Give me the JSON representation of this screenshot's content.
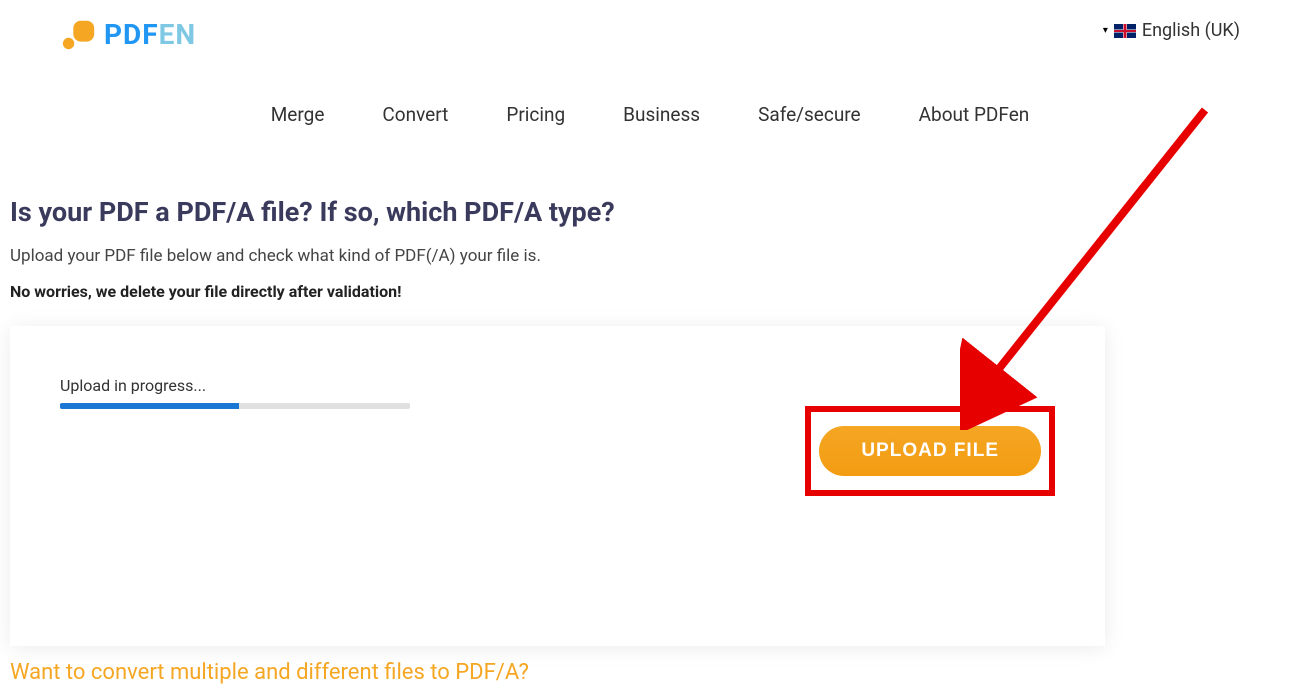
{
  "header": {
    "logo": {
      "text_pdf": "PDF",
      "text_en": "EN"
    },
    "language": {
      "label": "English (UK)"
    }
  },
  "nav": {
    "items": [
      "Merge",
      "Convert",
      "Pricing",
      "Business",
      "Safe/secure",
      "About PDFen"
    ]
  },
  "main": {
    "heading": "Is your PDF a PDF/A file? If so, which PDF/A type?",
    "subtext": "Upload your PDF file below and check what kind of PDF(/A) your file is.",
    "notice": "No worries, we delete your file directly after validation!",
    "upload": {
      "status": "Upload in progress...",
      "progress_percent": 51,
      "button_label": "UPLOAD FILE"
    },
    "bottom_link": "Want to convert multiple and different files to PDF/A?"
  },
  "colors": {
    "brand_orange": "#f5a623",
    "brand_blue": "#2196f3",
    "annotation_red": "#e60000"
  }
}
